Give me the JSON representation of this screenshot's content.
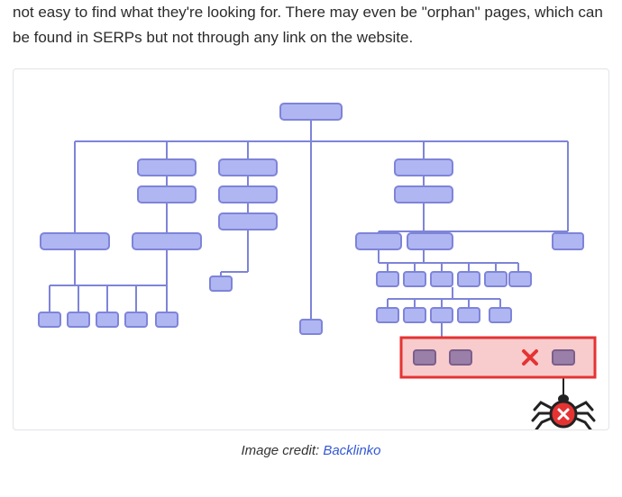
{
  "paragraph": "not easy to find what they're looking for. There may even be \"orphan\" pages, which can be found in SERPs but not through any link on the website.",
  "caption_prefix": "Image credit: ",
  "caption_link_text": "Backlinko",
  "diagram": {
    "description": "Deep, poorly-structured website architecture sitemap",
    "node_fill": "#b0b6f2",
    "node_stroke": "#7e84d8",
    "connector": "#7e84d8",
    "error_box_fill": "#f8cccc",
    "error_box_stroke": "#e53333",
    "error_node_fill": "#9a7fa8",
    "spider_body": "#222",
    "spider_badge": "#e53333"
  }
}
